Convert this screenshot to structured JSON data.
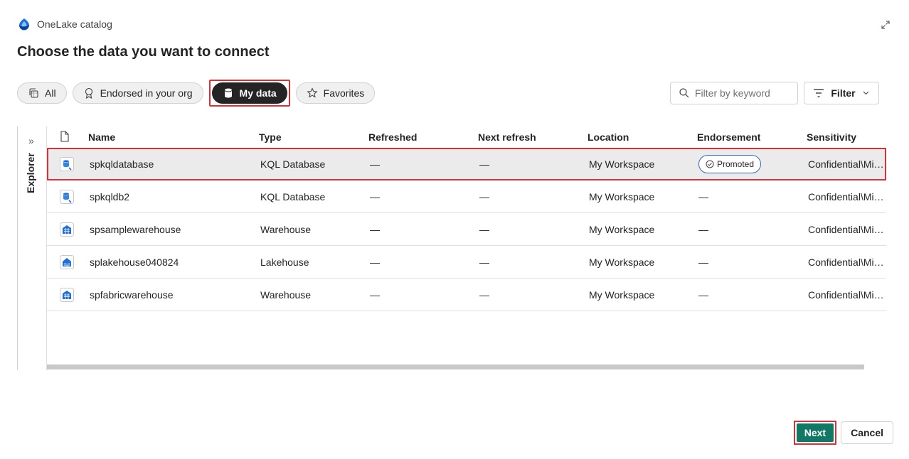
{
  "header": {
    "app_title": "OneLake catalog",
    "page_title": "Choose the data you want to connect"
  },
  "pills": [
    {
      "label": "All",
      "icon": "copy-stack-icon",
      "active": false
    },
    {
      "label": "Endorsed in your org",
      "icon": "ribbon-icon",
      "active": false
    },
    {
      "label": "My data",
      "icon": "database-icon",
      "active": true
    },
    {
      "label": "Favorites",
      "icon": "star-icon",
      "active": false
    }
  ],
  "search": {
    "placeholder": "Filter by keyword"
  },
  "filter": {
    "label": "Filter"
  },
  "explorer": {
    "label": "Explorer"
  },
  "columns": {
    "name": "Name",
    "type": "Type",
    "refreshed": "Refreshed",
    "next_refresh": "Next refresh",
    "location": "Location",
    "endorsement": "Endorsement",
    "sensitivity": "Sensitivity"
  },
  "rows": [
    {
      "name": "spkqldatabase",
      "type": "KQL Database",
      "refreshed": "—",
      "next_refresh": "—",
      "location": "My Workspace",
      "endorsement": "Promoted",
      "sensitivity": "Confidential\\Microsoft Extended",
      "icon": "kql-database-icon",
      "selected": true
    },
    {
      "name": "spkqldb2",
      "type": "KQL Database",
      "refreshed": "—",
      "next_refresh": "—",
      "location": "My Workspace",
      "endorsement": "—",
      "sensitivity": "Confidential\\Microsoft Extended",
      "icon": "kql-database-icon",
      "selected": false
    },
    {
      "name": "spsamplewarehouse",
      "type": "Warehouse",
      "refreshed": "—",
      "next_refresh": "—",
      "location": "My Workspace",
      "endorsement": "—",
      "sensitivity": "Confidential\\Microsoft Extended",
      "icon": "warehouse-icon",
      "selected": false
    },
    {
      "name": "splakehouse040824",
      "type": "Lakehouse",
      "refreshed": "—",
      "next_refresh": "—",
      "location": "My Workspace",
      "endorsement": "—",
      "sensitivity": "Confidential\\Microsoft Extended",
      "icon": "lakehouse-icon",
      "selected": false
    },
    {
      "name": "spfabricwarehouse",
      "type": "Warehouse",
      "refreshed": "—",
      "next_refresh": "—",
      "location": "My Workspace",
      "endorsement": "—",
      "sensitivity": "Confidential\\Microsoft Extended",
      "icon": "warehouse-icon",
      "selected": false
    }
  ],
  "footer": {
    "next_label": "Next",
    "cancel_label": "Cancel"
  },
  "colors": {
    "accent": "#117865",
    "highlight": "#d13438",
    "badge_border": "#3a66c8"
  }
}
